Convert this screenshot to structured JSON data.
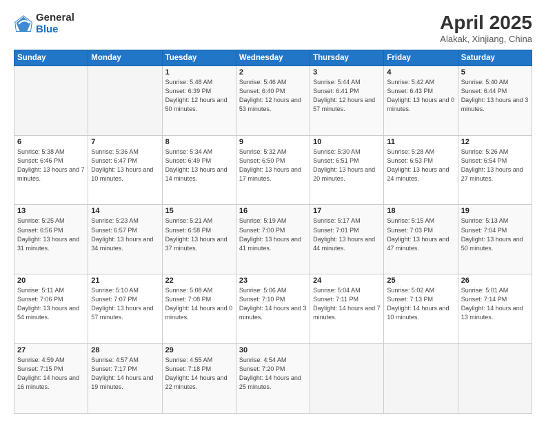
{
  "logo": {
    "general": "General",
    "blue": "Blue"
  },
  "header": {
    "title": "April 2025",
    "subtitle": "Alakak, Xinjiang, China"
  },
  "days_of_week": [
    "Sunday",
    "Monday",
    "Tuesday",
    "Wednesday",
    "Thursday",
    "Friday",
    "Saturday"
  ],
  "weeks": [
    [
      {
        "day": "",
        "info": ""
      },
      {
        "day": "",
        "info": ""
      },
      {
        "day": "1",
        "info": "Sunrise: 5:48 AM\nSunset: 6:39 PM\nDaylight: 12 hours and 50 minutes."
      },
      {
        "day": "2",
        "info": "Sunrise: 5:46 AM\nSunset: 6:40 PM\nDaylight: 12 hours and 53 minutes."
      },
      {
        "day": "3",
        "info": "Sunrise: 5:44 AM\nSunset: 6:41 PM\nDaylight: 12 hours and 57 minutes."
      },
      {
        "day": "4",
        "info": "Sunrise: 5:42 AM\nSunset: 6:43 PM\nDaylight: 13 hours and 0 minutes."
      },
      {
        "day": "5",
        "info": "Sunrise: 5:40 AM\nSunset: 6:44 PM\nDaylight: 13 hours and 3 minutes."
      }
    ],
    [
      {
        "day": "6",
        "info": "Sunrise: 5:38 AM\nSunset: 6:46 PM\nDaylight: 13 hours and 7 minutes."
      },
      {
        "day": "7",
        "info": "Sunrise: 5:36 AM\nSunset: 6:47 PM\nDaylight: 13 hours and 10 minutes."
      },
      {
        "day": "8",
        "info": "Sunrise: 5:34 AM\nSunset: 6:49 PM\nDaylight: 13 hours and 14 minutes."
      },
      {
        "day": "9",
        "info": "Sunrise: 5:32 AM\nSunset: 6:50 PM\nDaylight: 13 hours and 17 minutes."
      },
      {
        "day": "10",
        "info": "Sunrise: 5:30 AM\nSunset: 6:51 PM\nDaylight: 13 hours and 20 minutes."
      },
      {
        "day": "11",
        "info": "Sunrise: 5:28 AM\nSunset: 6:53 PM\nDaylight: 13 hours and 24 minutes."
      },
      {
        "day": "12",
        "info": "Sunrise: 5:26 AM\nSunset: 6:54 PM\nDaylight: 13 hours and 27 minutes."
      }
    ],
    [
      {
        "day": "13",
        "info": "Sunrise: 5:25 AM\nSunset: 6:56 PM\nDaylight: 13 hours and 31 minutes."
      },
      {
        "day": "14",
        "info": "Sunrise: 5:23 AM\nSunset: 6:57 PM\nDaylight: 13 hours and 34 minutes."
      },
      {
        "day": "15",
        "info": "Sunrise: 5:21 AM\nSunset: 6:58 PM\nDaylight: 13 hours and 37 minutes."
      },
      {
        "day": "16",
        "info": "Sunrise: 5:19 AM\nSunset: 7:00 PM\nDaylight: 13 hours and 41 minutes."
      },
      {
        "day": "17",
        "info": "Sunrise: 5:17 AM\nSunset: 7:01 PM\nDaylight: 13 hours and 44 minutes."
      },
      {
        "day": "18",
        "info": "Sunrise: 5:15 AM\nSunset: 7:03 PM\nDaylight: 13 hours and 47 minutes."
      },
      {
        "day": "19",
        "info": "Sunrise: 5:13 AM\nSunset: 7:04 PM\nDaylight: 13 hours and 50 minutes."
      }
    ],
    [
      {
        "day": "20",
        "info": "Sunrise: 5:11 AM\nSunset: 7:06 PM\nDaylight: 13 hours and 54 minutes."
      },
      {
        "day": "21",
        "info": "Sunrise: 5:10 AM\nSunset: 7:07 PM\nDaylight: 13 hours and 57 minutes."
      },
      {
        "day": "22",
        "info": "Sunrise: 5:08 AM\nSunset: 7:08 PM\nDaylight: 14 hours and 0 minutes."
      },
      {
        "day": "23",
        "info": "Sunrise: 5:06 AM\nSunset: 7:10 PM\nDaylight: 14 hours and 3 minutes."
      },
      {
        "day": "24",
        "info": "Sunrise: 5:04 AM\nSunset: 7:11 PM\nDaylight: 14 hours and 7 minutes."
      },
      {
        "day": "25",
        "info": "Sunrise: 5:02 AM\nSunset: 7:13 PM\nDaylight: 14 hours and 10 minutes."
      },
      {
        "day": "26",
        "info": "Sunrise: 5:01 AM\nSunset: 7:14 PM\nDaylight: 14 hours and 13 minutes."
      }
    ],
    [
      {
        "day": "27",
        "info": "Sunrise: 4:59 AM\nSunset: 7:15 PM\nDaylight: 14 hours and 16 minutes."
      },
      {
        "day": "28",
        "info": "Sunrise: 4:57 AM\nSunset: 7:17 PM\nDaylight: 14 hours and 19 minutes."
      },
      {
        "day": "29",
        "info": "Sunrise: 4:55 AM\nSunset: 7:18 PM\nDaylight: 14 hours and 22 minutes."
      },
      {
        "day": "30",
        "info": "Sunrise: 4:54 AM\nSunset: 7:20 PM\nDaylight: 14 hours and 25 minutes."
      },
      {
        "day": "",
        "info": ""
      },
      {
        "day": "",
        "info": ""
      },
      {
        "day": "",
        "info": ""
      }
    ]
  ]
}
